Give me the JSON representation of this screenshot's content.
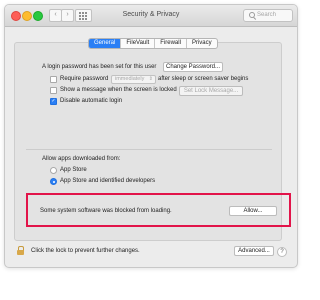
{
  "window": {
    "title": "Security & Privacy",
    "nav_back": "‹",
    "nav_forward": "›",
    "search_placeholder": "Search"
  },
  "tabs": [
    {
      "label": "General",
      "active": true
    },
    {
      "label": "FileVault",
      "active": false
    },
    {
      "label": "Firewall",
      "active": false
    },
    {
      "label": "Privacy",
      "active": false
    }
  ],
  "login": {
    "password_text": "A login password has been set for this user",
    "change_password_button": "Change Password...",
    "require_password_label": "Require password",
    "require_password_checked": false,
    "require_password_value": "immediately",
    "require_password_suffix": "after sleep or screen saver begins",
    "show_message_label": "Show a message when the screen is locked",
    "show_message_checked": false,
    "set_lock_message_button": "Set Lock Message...",
    "disable_auto_login_label": "Disable automatic login",
    "disable_auto_login_checked": true
  },
  "downloads": {
    "heading": "Allow apps downloaded from:",
    "options": [
      {
        "label": "App Store",
        "selected": false
      },
      {
        "label": "App Store and identified developers",
        "selected": true
      }
    ]
  },
  "blocked": {
    "message": "Some system software was blocked from loading.",
    "allow_button": "Allow..."
  },
  "footer": {
    "lock_text": "Click the lock to prevent further changes.",
    "advanced_button": "Advanced...",
    "help_glyph": "?"
  },
  "colors": {
    "accent": "#2a7ff5",
    "highlight_border": "#e2144a",
    "window_bg": "#ececec"
  }
}
